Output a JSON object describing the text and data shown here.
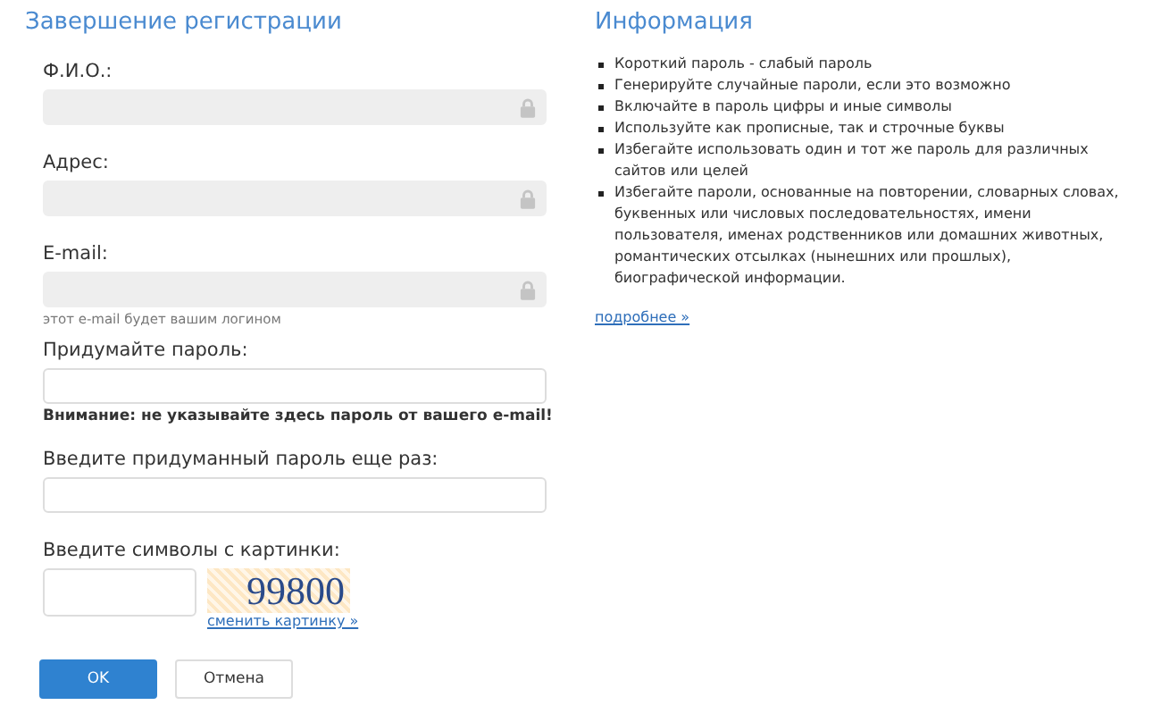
{
  "form": {
    "title": "Завершение регистрации",
    "fields": [
      {
        "label": "Ф.И.О.:",
        "disabled": true
      },
      {
        "label": "Адрес:",
        "disabled": true
      },
      {
        "label": "E-mail:",
        "disabled": true,
        "hint": "этот e-mail будет вашим логином"
      },
      {
        "label": "Придумайте пароль:",
        "disabled": false,
        "warning": "Внимание: не указывайте здесь пароль от вашего e-mail!"
      },
      {
        "label": "Введите придуманный пароль еще раз:",
        "disabled": false
      }
    ],
    "captcha": {
      "label": "Введите символы с картинки:",
      "code": "99800",
      "change_link": "сменить картинку »"
    },
    "buttons": [
      {
        "label": "OK",
        "kind": "primary"
      },
      {
        "label": "Отмена",
        "kind": "secondary"
      }
    ]
  },
  "info": {
    "title": "Информация",
    "items": [
      "Короткий пароль - слабый пароль",
      "Генерируйте случайные пароли, если это возможно",
      "Включайте в пароль цифры и иные символы",
      "Используйте как прописные, так и строчные буквы",
      "Избегайте использовать один и тот же пароль для различных сайтов или целей",
      "Избегайте пароли, основанные на повторении, словарных словах, буквенных или числовых последовательностях, имени пользователя, именах родственников или домашних животных, романтических отсылках (нынешних или прошлых), биографической информации."
    ],
    "more_link": "подробнее »"
  }
}
